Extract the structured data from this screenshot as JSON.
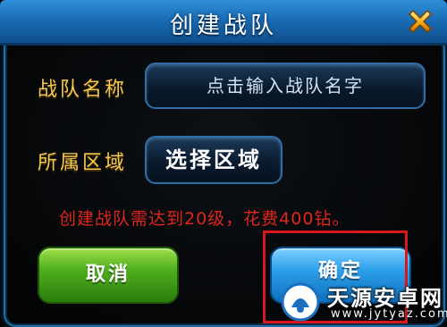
{
  "dialog": {
    "title": "创建战队",
    "close_icon": "close-x-icon",
    "team_name_label": "战队名称",
    "team_name_placeholder": "点击输入战队名字",
    "region_label": "所属区域",
    "region_select_label": "选择区域",
    "notice": "创建战队需达到20级，花费400钻。",
    "cancel_label": "取消",
    "confirm_label": "确定"
  },
  "watermark": {
    "title": "天源安卓网",
    "url": "www.jytyaz.com"
  },
  "colors": {
    "title_bar": "#1a6db6",
    "label": "#f7c84d",
    "notice": "#e0261c",
    "cancel": "#4fae1e",
    "confirm": "#2ea0ea",
    "highlight": "#d8181b"
  }
}
